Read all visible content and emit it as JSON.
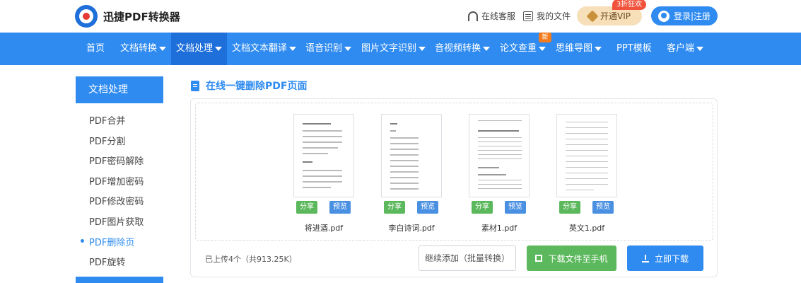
{
  "header": {
    "logo_text": "迅捷PDF转换器",
    "service_label": "在线客服",
    "files_label": "我的文件",
    "vip_label": "开通VIP",
    "vip_badge": "3折狂欢",
    "login_label": "登录|注册"
  },
  "nav": {
    "items": [
      {
        "label": "首页"
      },
      {
        "label": "文档转换"
      },
      {
        "label": "文档处理"
      },
      {
        "label": "文档文本翻译"
      },
      {
        "label": "语音识别"
      },
      {
        "label": "图片文字识别"
      },
      {
        "label": "音视频转换"
      },
      {
        "label": "论文查重"
      },
      {
        "label": "思维导图"
      },
      {
        "label": "PPT模板"
      },
      {
        "label": "客户端"
      }
    ],
    "active": "文档处理",
    "new_badge": "新"
  },
  "sidebar": {
    "title": "文档处理",
    "items": [
      {
        "label": "PDF合并"
      },
      {
        "label": "PDF分割"
      },
      {
        "label": "PDF密码解除"
      },
      {
        "label": "PDF增加密码"
      },
      {
        "label": "PDF修改密码"
      },
      {
        "label": "PDF图片获取"
      },
      {
        "label": "PDF删除页"
      },
      {
        "label": "PDF旋转"
      }
    ],
    "active": "PDF删除页"
  },
  "main": {
    "title": "在线一键删除PDF页面",
    "files": [
      {
        "name": "将进酒.pdf",
        "share": "分享",
        "preview": "预览"
      },
      {
        "name": "李白诗词.pdf",
        "share": "分享",
        "preview": "预览"
      },
      {
        "name": "素材1.pdf",
        "share": "分享",
        "preview": "预览"
      },
      {
        "name": "英文1.pdf",
        "share": "分享",
        "preview": "预览"
      }
    ],
    "count_text": "已上传4个（共913.25K）",
    "continue_label": "继续添加（批量转换）",
    "phone_label": "下载文件至手机",
    "download_label": "立即下载"
  },
  "colors": {
    "primary": "#2f8bf0",
    "primary_dark": "#1e6fd9",
    "green": "#5cb85c",
    "vip_bg": "#f6dfb9",
    "badge_red": "#f0523c"
  }
}
